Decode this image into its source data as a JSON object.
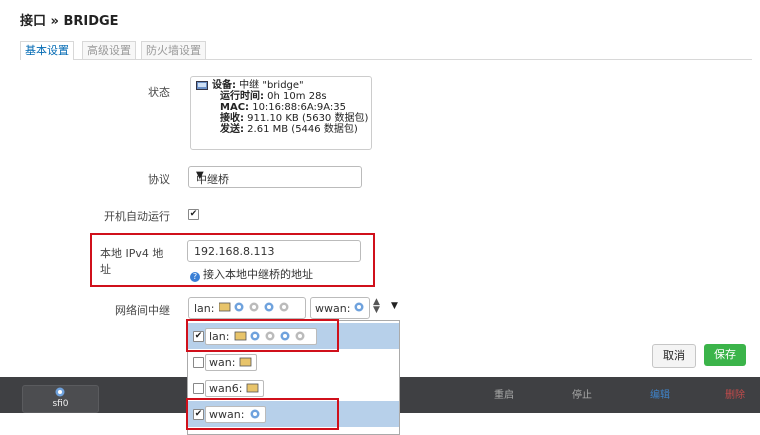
{
  "page": {
    "title": "接口 » BRIDGE"
  },
  "tabs": [
    {
      "label": "基本设置"
    },
    {
      "label": "高级设置"
    },
    {
      "label": "防火墙设置"
    }
  ],
  "status": {
    "label": "状态",
    "device_key": "设备:",
    "device_val": " 中继 \"bridge\"",
    "uptime_key": "运行时间:",
    "uptime_val": " 0h 10m 28s",
    "mac_key": "MAC:",
    "mac_val": " 10:16:88:6A:9A:35",
    "rx_key": "接收:",
    "rx_val": " 911.10 KB (5630 数据包)",
    "tx_key": "发送:",
    "tx_val": " 2.61 MB (5446 数据包)"
  },
  "protocol": {
    "label": "协议",
    "value": "中继桥"
  },
  "autostart": {
    "label": "开机自动运行",
    "checked": true,
    "mark": "✔"
  },
  "ipv4": {
    "label": "本地 IPv4 地址",
    "value": "192.168.8.113",
    "help": "接入本地中继桥的地址"
  },
  "relay": {
    "label": "网络间中继",
    "selected_a": "lan:",
    "selected_b": "wwan:",
    "spin_up": "▲",
    "spin_down": "▼",
    "caret": "▼",
    "options": [
      {
        "label": "lan:",
        "checked": true,
        "mark": "✔"
      },
      {
        "label": "wan:",
        "checked": false,
        "mark": ""
      },
      {
        "label": "wan6:",
        "checked": false,
        "mark": ""
      },
      {
        "label": "wwan:",
        "checked": true,
        "mark": "✔"
      }
    ]
  },
  "footer_bar": {
    "iface_name": "sfi0",
    "buttons": [
      "重启",
      "停止",
      "编辑",
      "删除"
    ]
  },
  "actions": {
    "cancel": "取消",
    "save": "保存"
  },
  "colors": {
    "accent_blue": "#0069b3",
    "save_green": "#3bb44a",
    "highlight_red": "#d0101b",
    "selected_row": "#b7d0ea"
  }
}
